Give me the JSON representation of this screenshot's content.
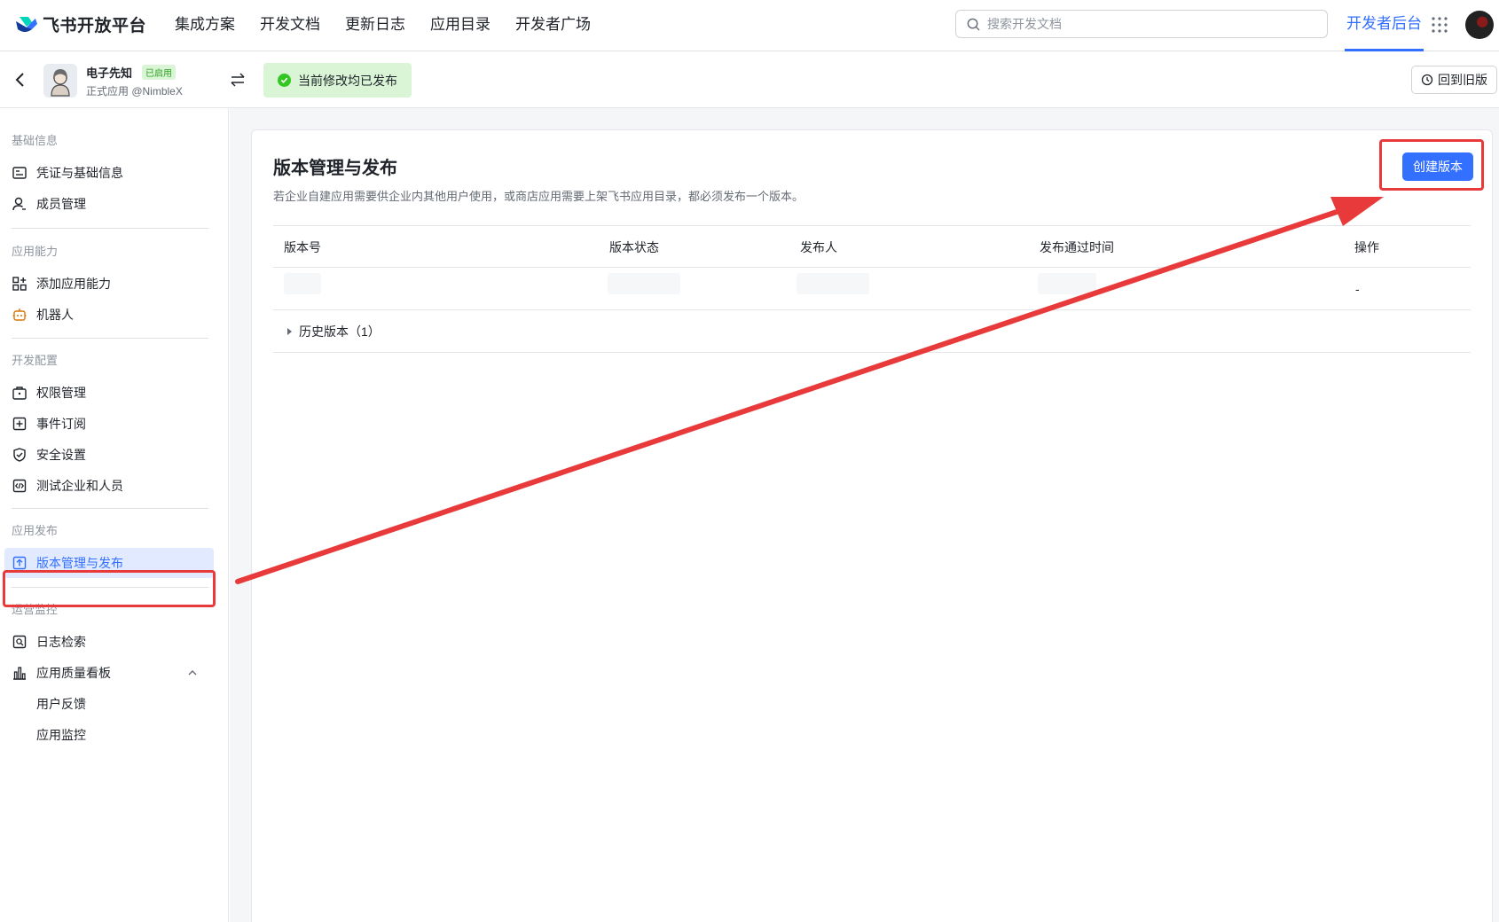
{
  "topnav": {
    "brand": "飞书开放平台",
    "links": [
      "集成方案",
      "开发文档",
      "更新日志",
      "应用目录",
      "开发者广场"
    ],
    "search_placeholder": "搜索开发文档",
    "dev_console": "开发者后台"
  },
  "app": {
    "name": "电子先知",
    "badge": "已启用",
    "subtitle": "正式应用 @NimbleX",
    "status": "当前修改均已发布",
    "revert": "回到旧版"
  },
  "sidebar": {
    "sections": [
      {
        "title": "基础信息",
        "items": [
          {
            "label": "凭证与基础信息",
            "icon": "id-card-icon"
          },
          {
            "label": "成员管理",
            "icon": "user-icon"
          }
        ]
      },
      {
        "title": "应用能力",
        "items": [
          {
            "label": "添加应用能力",
            "icon": "apps-add-icon"
          },
          {
            "label": "机器人",
            "icon": "robot-icon"
          }
        ]
      },
      {
        "title": "开发配置",
        "items": [
          {
            "label": "权限管理",
            "icon": "briefcase-icon"
          },
          {
            "label": "事件订阅",
            "icon": "event-icon"
          },
          {
            "label": "安全设置",
            "icon": "shield-icon"
          },
          {
            "label": "测试企业和人员",
            "icon": "code-icon"
          }
        ]
      },
      {
        "title": "应用发布",
        "items": [
          {
            "label": "版本管理与发布",
            "icon": "upload-icon",
            "active": true
          }
        ]
      },
      {
        "title": "运营监控",
        "items": [
          {
            "label": "日志检索",
            "icon": "log-search-icon"
          },
          {
            "label": "应用质量看板",
            "icon": "bar-chart-icon"
          },
          {
            "label": "用户反馈"
          },
          {
            "label": "应用监控"
          }
        ]
      }
    ]
  },
  "main": {
    "title": "版本管理与发布",
    "description": "若企业自建应用需要供企业内其他用户使用，或商店应用需要上架飞书应用目录，都必须发布一个版本。",
    "create_button": "创建版本",
    "table": {
      "headers": [
        "版本号",
        "版本状态",
        "发布人",
        "发布通过时间",
        "操作"
      ],
      "row_action": "-"
    },
    "history": "历史版本（1）"
  },
  "colors": {
    "accent": "#3370ff",
    "annotation": "#e83a3a",
    "success_bg": "#d9f5d6"
  }
}
